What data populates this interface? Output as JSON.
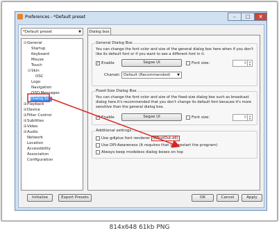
{
  "window": {
    "title": "Preferences - *Default preset"
  },
  "preset": {
    "value": "*Default preset"
  },
  "tree": [
    {
      "label": "General",
      "exp": "⊟"
    },
    {
      "label": "Startup",
      "exp": ""
    },
    {
      "label": "Keyboard",
      "exp": ""
    },
    {
      "label": "Mouse",
      "exp": ""
    },
    {
      "label": "Touch",
      "exp": ""
    },
    {
      "label": "Skin",
      "exp": "⊟"
    },
    {
      "label": "OSC",
      "exp": ""
    },
    {
      "label": "Logo",
      "exp": ""
    },
    {
      "label": "Navigation",
      "exp": ""
    },
    {
      "label": "OSD Messages",
      "exp": ""
    },
    {
      "label": "Dialog box",
      "exp": ""
    },
    {
      "label": "Playback",
      "exp": "⊞"
    },
    {
      "label": "Device",
      "exp": "⊞"
    },
    {
      "label": "Filter Control",
      "exp": "⊞"
    },
    {
      "label": "Subtitles",
      "exp": "⊞"
    },
    {
      "label": "Video",
      "exp": "⊞"
    },
    {
      "label": "Audio",
      "exp": "⊞"
    },
    {
      "label": "Network",
      "exp": ""
    },
    {
      "label": "Location",
      "exp": ""
    },
    {
      "label": "Accessibility",
      "exp": ""
    },
    {
      "label": "Association",
      "exp": ""
    },
    {
      "label": "Configuration",
      "exp": ""
    }
  ],
  "tab": {
    "label": "Dialog box"
  },
  "general_box": {
    "title": "General Dialog Box",
    "desc": "You can change the font color and size of the general dialog box here when if you don't like its default font or if you want to see a different font in it.",
    "enable_label": "Enable",
    "font_button": "Segoe UI",
    "font_size_label": "Font size:",
    "font_size_value": "9",
    "charset_label": "Charset:",
    "charset_value": "Default (Recommended)"
  },
  "fixed_box": {
    "title": "Fixed-Size Dialog Box",
    "desc": "You can change the font color and size of the fixed-size dialog box such as broadcast dialog here.It's recommended that you don't change its default font because it's more sensitive than the general dialog box.",
    "enable_label": "Enable",
    "font_button": "Segoe UI",
    "font_size_label": "Font size:",
    "font_size_value": "9"
  },
  "additional": {
    "title": "Additional settings",
    "gdiplus_prefix": "Use gdiplus font renderer ",
    "gdiplus_highlight": "(ATextOut.dll)",
    "dpi_label": "Use DPI-Awareness (It requires that you restart the program)",
    "modeless_label": "Always keep modeless dialog boxes on top"
  },
  "buttons": {
    "initialize": "Initialize",
    "export": "Export Presets",
    "ok": "OK",
    "cancel": "Cancel",
    "apply": "Apply"
  },
  "footer": "814x648 61kb PNG",
  "colors": {
    "selection": "#3399ff",
    "annotation": "#dd2222"
  },
  "icons": {
    "checked": "✓",
    "dropdown": "▼"
  }
}
